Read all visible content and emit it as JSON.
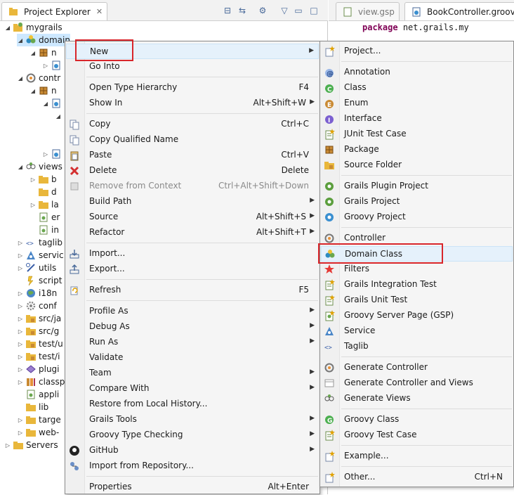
{
  "explorer": {
    "tab_title": "Project Explorer",
    "tree": [
      {
        "label": "mygrails",
        "icon": "project-icon",
        "indent": 0,
        "twisty": "open"
      },
      {
        "label": "domain",
        "icon": "domain-folder-icon",
        "indent": 1,
        "twisty": "open",
        "selected": true
      },
      {
        "label": "n",
        "icon": "package-icon",
        "indent": 2,
        "twisty": "open"
      },
      {
        "label": "",
        "icon": "groovy-file-icon",
        "indent": 3,
        "twisty": "closed"
      },
      {
        "label": "contr",
        "icon": "controllers-folder-icon",
        "indent": 1,
        "twisty": "open"
      },
      {
        "label": "n",
        "icon": "package-icon",
        "indent": 2,
        "twisty": "open"
      },
      {
        "label": "",
        "icon": "groovy-file-icon",
        "indent": 3,
        "twisty": "open"
      },
      {
        "label": "",
        "icon": "",
        "indent": 4,
        "twisty": "open"
      },
      {
        "label": "",
        "icon": "",
        "indent": 4,
        "twisty": ""
      },
      {
        "label": "",
        "icon": "",
        "indent": 4,
        "twisty": ""
      },
      {
        "label": "",
        "icon": "groovy-file-icon",
        "indent": 3,
        "twisty": "closed"
      },
      {
        "label": "views",
        "icon": "views-folder-icon",
        "indent": 1,
        "twisty": "open"
      },
      {
        "label": "b",
        "icon": "folder-icon",
        "indent": 2,
        "twisty": "closed"
      },
      {
        "label": "d",
        "icon": "folder-icon",
        "indent": 2,
        "twisty": ""
      },
      {
        "label": "la",
        "icon": "folder-icon",
        "indent": 2,
        "twisty": "closed"
      },
      {
        "label": "er",
        "icon": "gsp-file-icon",
        "indent": 2,
        "twisty": ""
      },
      {
        "label": "in",
        "icon": "gsp-file-icon",
        "indent": 2,
        "twisty": ""
      },
      {
        "label": "taglib",
        "icon": "taglib-folder-icon",
        "indent": 1,
        "twisty": "closed"
      },
      {
        "label": "servic",
        "icon": "services-folder-icon",
        "indent": 1,
        "twisty": "closed"
      },
      {
        "label": "utils",
        "icon": "utils-folder-icon",
        "indent": 1,
        "twisty": "closed"
      },
      {
        "label": "script",
        "icon": "scripts-folder-icon",
        "indent": 1,
        "twisty": ""
      },
      {
        "label": "i18n",
        "icon": "i18n-folder-icon",
        "indent": 1,
        "twisty": "closed"
      },
      {
        "label": "conf",
        "icon": "conf-folder-icon",
        "indent": 1,
        "twisty": "closed"
      },
      {
        "label": "src/ja",
        "icon": "source-folder-icon",
        "indent": 1,
        "twisty": "closed"
      },
      {
        "label": "src/g",
        "icon": "source-folder-icon",
        "indent": 1,
        "twisty": "closed"
      },
      {
        "label": "test/u",
        "icon": "source-folder-icon",
        "indent": 1,
        "twisty": "closed"
      },
      {
        "label": "test/i",
        "icon": "source-folder-icon",
        "indent": 1,
        "twisty": "closed"
      },
      {
        "label": "plugi",
        "icon": "plugins-icon",
        "indent": 1,
        "twisty": "closed"
      },
      {
        "label": "classp",
        "icon": "library-icon",
        "indent": 1,
        "twisty": "closed"
      },
      {
        "label": "appli",
        "icon": "file-icon",
        "indent": 1,
        "twisty": ""
      },
      {
        "label": "lib",
        "icon": "folder-icon",
        "indent": 1,
        "twisty": ""
      },
      {
        "label": "targe",
        "icon": "folder-icon",
        "indent": 1,
        "twisty": "closed"
      },
      {
        "label": "web-",
        "icon": "folder-icon",
        "indent": 1,
        "twisty": "closed"
      },
      {
        "label": "Servers",
        "icon": "servers-folder-icon",
        "indent": 0,
        "twisty": "closed"
      }
    ]
  },
  "editor": {
    "tabs": [
      {
        "label": "view.gsp",
        "active": false
      },
      {
        "label": "BookController.groovy",
        "active": true
      }
    ],
    "code_keyword": "package",
    "code_rest": "net.grails.my"
  },
  "context_menu": {
    "items": [
      {
        "type": "item",
        "label": "New",
        "shortcut": "",
        "submenu": true,
        "icon": "",
        "hover": true
      },
      {
        "type": "item",
        "label": "Go Into",
        "shortcut": "",
        "submenu": false,
        "icon": ""
      },
      {
        "type": "sep"
      },
      {
        "type": "item",
        "label": "Open Type Hierarchy",
        "shortcut": "F4",
        "submenu": false,
        "icon": ""
      },
      {
        "type": "item",
        "label": "Show In",
        "shortcut": "Alt+Shift+W",
        "submenu": true,
        "icon": ""
      },
      {
        "type": "sep"
      },
      {
        "type": "item",
        "label": "Copy",
        "shortcut": "Ctrl+C",
        "submenu": false,
        "icon": "copy-icon"
      },
      {
        "type": "item",
        "label": "Copy Qualified Name",
        "shortcut": "",
        "submenu": false,
        "icon": "copy-qualified-icon"
      },
      {
        "type": "item",
        "label": "Paste",
        "shortcut": "Ctrl+V",
        "submenu": false,
        "icon": "paste-icon"
      },
      {
        "type": "item",
        "label": "Delete",
        "shortcut": "Delete",
        "submenu": false,
        "icon": "delete-icon"
      },
      {
        "type": "item",
        "label": "Remove from Context",
        "shortcut": "Ctrl+Alt+Shift+Down",
        "submenu": false,
        "icon": "remove-context-icon",
        "disabled": true
      },
      {
        "type": "item",
        "label": "Build Path",
        "shortcut": "",
        "submenu": true,
        "icon": ""
      },
      {
        "type": "item",
        "label": "Source",
        "shortcut": "Alt+Shift+S",
        "submenu": true,
        "icon": ""
      },
      {
        "type": "item",
        "label": "Refactor",
        "shortcut": "Alt+Shift+T",
        "submenu": true,
        "icon": ""
      },
      {
        "type": "sep"
      },
      {
        "type": "item",
        "label": "Import...",
        "shortcut": "",
        "submenu": false,
        "icon": "import-icon"
      },
      {
        "type": "item",
        "label": "Export...",
        "shortcut": "",
        "submenu": false,
        "icon": "export-icon"
      },
      {
        "type": "sep"
      },
      {
        "type": "item",
        "label": "Refresh",
        "shortcut": "F5",
        "submenu": false,
        "icon": "refresh-icon"
      },
      {
        "type": "sep"
      },
      {
        "type": "item",
        "label": "Profile As",
        "shortcut": "",
        "submenu": true,
        "icon": ""
      },
      {
        "type": "item",
        "label": "Debug As",
        "shortcut": "",
        "submenu": true,
        "icon": ""
      },
      {
        "type": "item",
        "label": "Run As",
        "shortcut": "",
        "submenu": true,
        "icon": ""
      },
      {
        "type": "item",
        "label": "Validate",
        "shortcut": "",
        "submenu": false,
        "icon": ""
      },
      {
        "type": "item",
        "label": "Team",
        "shortcut": "",
        "submenu": true,
        "icon": ""
      },
      {
        "type": "item",
        "label": "Compare With",
        "shortcut": "",
        "submenu": true,
        "icon": ""
      },
      {
        "type": "item",
        "label": "Restore from Local History...",
        "shortcut": "",
        "submenu": false,
        "icon": ""
      },
      {
        "type": "item",
        "label": "Grails Tools",
        "shortcut": "",
        "submenu": true,
        "icon": ""
      },
      {
        "type": "item",
        "label": "Groovy Type Checking",
        "shortcut": "",
        "submenu": true,
        "icon": ""
      },
      {
        "type": "item",
        "label": "GitHub",
        "shortcut": "",
        "submenu": true,
        "icon": "github-icon"
      },
      {
        "type": "item",
        "label": "Import from Repository...",
        "shortcut": "",
        "submenu": false,
        "icon": "repository-icon"
      },
      {
        "type": "sep"
      },
      {
        "type": "item",
        "label": "Properties",
        "shortcut": "Alt+Enter",
        "submenu": false,
        "icon": ""
      }
    ]
  },
  "submenu": {
    "items": [
      {
        "type": "item",
        "label": "Project...",
        "shortcut": "",
        "icon": "new-project-icon"
      },
      {
        "type": "sep"
      },
      {
        "type": "item",
        "label": "Annotation",
        "shortcut": "",
        "icon": "annotation-icon"
      },
      {
        "type": "item",
        "label": "Class",
        "shortcut": "",
        "icon": "class-icon"
      },
      {
        "type": "item",
        "label": "Enum",
        "shortcut": "",
        "icon": "enum-icon"
      },
      {
        "type": "item",
        "label": "Interface",
        "shortcut": "",
        "icon": "interface-icon"
      },
      {
        "type": "item",
        "label": "JUnit Test Case",
        "shortcut": "",
        "icon": "junit-icon"
      },
      {
        "type": "item",
        "label": "Package",
        "shortcut": "",
        "icon": "new-package-icon"
      },
      {
        "type": "item",
        "label": "Source Folder",
        "shortcut": "",
        "icon": "source-folder-icon"
      },
      {
        "type": "sep"
      },
      {
        "type": "item",
        "label": "Grails Plugin Project",
        "shortcut": "",
        "icon": "grails-plugin-icon"
      },
      {
        "type": "item",
        "label": "Grails Project",
        "shortcut": "",
        "icon": "grails-project-icon"
      },
      {
        "type": "item",
        "label": "Groovy Project",
        "shortcut": "",
        "icon": "groovy-project-icon"
      },
      {
        "type": "sep"
      },
      {
        "type": "item",
        "label": "Controller",
        "shortcut": "",
        "icon": "controller-icon"
      },
      {
        "type": "item",
        "label": "Domain Class",
        "shortcut": "",
        "icon": "domain-class-icon",
        "hover": true
      },
      {
        "type": "item",
        "label": "Filters",
        "shortcut": "",
        "icon": "filters-icon"
      },
      {
        "type": "item",
        "label": "Grails Integration Test",
        "shortcut": "",
        "icon": "integration-test-icon"
      },
      {
        "type": "item",
        "label": "Grails Unit Test",
        "shortcut": "",
        "icon": "unit-test-icon"
      },
      {
        "type": "item",
        "label": "Groovy Server Page (GSP)",
        "shortcut": "",
        "icon": "gsp-icon"
      },
      {
        "type": "item",
        "label": "Service",
        "shortcut": "",
        "icon": "service-icon"
      },
      {
        "type": "item",
        "label": "Taglib",
        "shortcut": "",
        "icon": "taglib-icon"
      },
      {
        "type": "sep"
      },
      {
        "type": "item",
        "label": "Generate Controller",
        "shortcut": "",
        "icon": "generate-controller-icon"
      },
      {
        "type": "item",
        "label": "Generate Controller and Views",
        "shortcut": "",
        "icon": "generate-controller-views-icon"
      },
      {
        "type": "item",
        "label": "Generate Views",
        "shortcut": "",
        "icon": "generate-views-icon"
      },
      {
        "type": "sep"
      },
      {
        "type": "item",
        "label": "Groovy Class",
        "shortcut": "",
        "icon": "groovy-class-icon"
      },
      {
        "type": "item",
        "label": "Groovy Test Case",
        "shortcut": "",
        "icon": "groovy-test-icon"
      },
      {
        "type": "sep"
      },
      {
        "type": "item",
        "label": "Example...",
        "shortcut": "",
        "icon": "example-icon"
      },
      {
        "type": "sep"
      },
      {
        "type": "item",
        "label": "Other...",
        "shortcut": "Ctrl+N",
        "icon": "other-icon"
      }
    ]
  },
  "colors": {
    "highlight_box": "#d8262b",
    "hover_bg": "#e5f1fb",
    "keyword": "#7f0055"
  }
}
